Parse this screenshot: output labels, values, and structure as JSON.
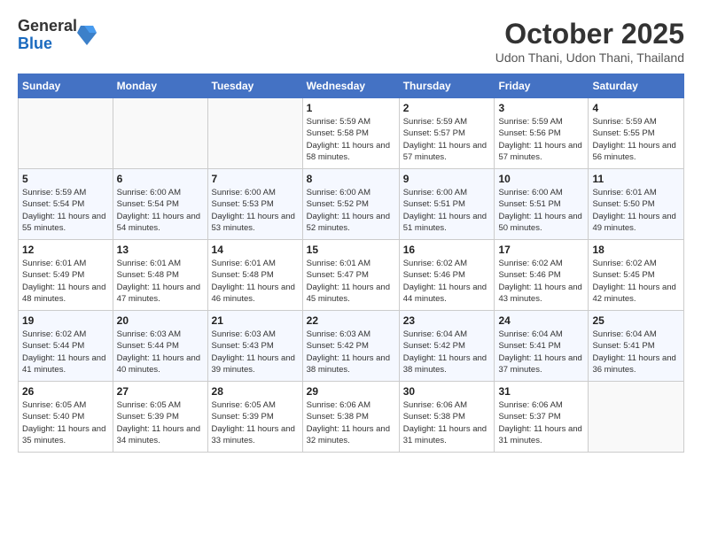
{
  "header": {
    "logo_general": "General",
    "logo_blue": "Blue",
    "month_title": "October 2025",
    "location": "Udon Thani, Udon Thani, Thailand"
  },
  "days_of_week": [
    "Sunday",
    "Monday",
    "Tuesday",
    "Wednesday",
    "Thursday",
    "Friday",
    "Saturday"
  ],
  "weeks": [
    [
      {
        "day": "",
        "info": ""
      },
      {
        "day": "",
        "info": ""
      },
      {
        "day": "",
        "info": ""
      },
      {
        "day": "1",
        "info": "Sunrise: 5:59 AM\nSunset: 5:58 PM\nDaylight: 11 hours and 58 minutes."
      },
      {
        "day": "2",
        "info": "Sunrise: 5:59 AM\nSunset: 5:57 PM\nDaylight: 11 hours and 57 minutes."
      },
      {
        "day": "3",
        "info": "Sunrise: 5:59 AM\nSunset: 5:56 PM\nDaylight: 11 hours and 57 minutes."
      },
      {
        "day": "4",
        "info": "Sunrise: 5:59 AM\nSunset: 5:55 PM\nDaylight: 11 hours and 56 minutes."
      }
    ],
    [
      {
        "day": "5",
        "info": "Sunrise: 5:59 AM\nSunset: 5:54 PM\nDaylight: 11 hours and 55 minutes."
      },
      {
        "day": "6",
        "info": "Sunrise: 6:00 AM\nSunset: 5:54 PM\nDaylight: 11 hours and 54 minutes."
      },
      {
        "day": "7",
        "info": "Sunrise: 6:00 AM\nSunset: 5:53 PM\nDaylight: 11 hours and 53 minutes."
      },
      {
        "day": "8",
        "info": "Sunrise: 6:00 AM\nSunset: 5:52 PM\nDaylight: 11 hours and 52 minutes."
      },
      {
        "day": "9",
        "info": "Sunrise: 6:00 AM\nSunset: 5:51 PM\nDaylight: 11 hours and 51 minutes."
      },
      {
        "day": "10",
        "info": "Sunrise: 6:00 AM\nSunset: 5:51 PM\nDaylight: 11 hours and 50 minutes."
      },
      {
        "day": "11",
        "info": "Sunrise: 6:01 AM\nSunset: 5:50 PM\nDaylight: 11 hours and 49 minutes."
      }
    ],
    [
      {
        "day": "12",
        "info": "Sunrise: 6:01 AM\nSunset: 5:49 PM\nDaylight: 11 hours and 48 minutes."
      },
      {
        "day": "13",
        "info": "Sunrise: 6:01 AM\nSunset: 5:48 PM\nDaylight: 11 hours and 47 minutes."
      },
      {
        "day": "14",
        "info": "Sunrise: 6:01 AM\nSunset: 5:48 PM\nDaylight: 11 hours and 46 minutes."
      },
      {
        "day": "15",
        "info": "Sunrise: 6:01 AM\nSunset: 5:47 PM\nDaylight: 11 hours and 45 minutes."
      },
      {
        "day": "16",
        "info": "Sunrise: 6:02 AM\nSunset: 5:46 PM\nDaylight: 11 hours and 44 minutes."
      },
      {
        "day": "17",
        "info": "Sunrise: 6:02 AM\nSunset: 5:46 PM\nDaylight: 11 hours and 43 minutes."
      },
      {
        "day": "18",
        "info": "Sunrise: 6:02 AM\nSunset: 5:45 PM\nDaylight: 11 hours and 42 minutes."
      }
    ],
    [
      {
        "day": "19",
        "info": "Sunrise: 6:02 AM\nSunset: 5:44 PM\nDaylight: 11 hours and 41 minutes."
      },
      {
        "day": "20",
        "info": "Sunrise: 6:03 AM\nSunset: 5:44 PM\nDaylight: 11 hours and 40 minutes."
      },
      {
        "day": "21",
        "info": "Sunrise: 6:03 AM\nSunset: 5:43 PM\nDaylight: 11 hours and 39 minutes."
      },
      {
        "day": "22",
        "info": "Sunrise: 6:03 AM\nSunset: 5:42 PM\nDaylight: 11 hours and 38 minutes."
      },
      {
        "day": "23",
        "info": "Sunrise: 6:04 AM\nSunset: 5:42 PM\nDaylight: 11 hours and 38 minutes."
      },
      {
        "day": "24",
        "info": "Sunrise: 6:04 AM\nSunset: 5:41 PM\nDaylight: 11 hours and 37 minutes."
      },
      {
        "day": "25",
        "info": "Sunrise: 6:04 AM\nSunset: 5:41 PM\nDaylight: 11 hours and 36 minutes."
      }
    ],
    [
      {
        "day": "26",
        "info": "Sunrise: 6:05 AM\nSunset: 5:40 PM\nDaylight: 11 hours and 35 minutes."
      },
      {
        "day": "27",
        "info": "Sunrise: 6:05 AM\nSunset: 5:39 PM\nDaylight: 11 hours and 34 minutes."
      },
      {
        "day": "28",
        "info": "Sunrise: 6:05 AM\nSunset: 5:39 PM\nDaylight: 11 hours and 33 minutes."
      },
      {
        "day": "29",
        "info": "Sunrise: 6:06 AM\nSunset: 5:38 PM\nDaylight: 11 hours and 32 minutes."
      },
      {
        "day": "30",
        "info": "Sunrise: 6:06 AM\nSunset: 5:38 PM\nDaylight: 11 hours and 31 minutes."
      },
      {
        "day": "31",
        "info": "Sunrise: 6:06 AM\nSunset: 5:37 PM\nDaylight: 11 hours and 31 minutes."
      },
      {
        "day": "",
        "info": ""
      }
    ]
  ]
}
